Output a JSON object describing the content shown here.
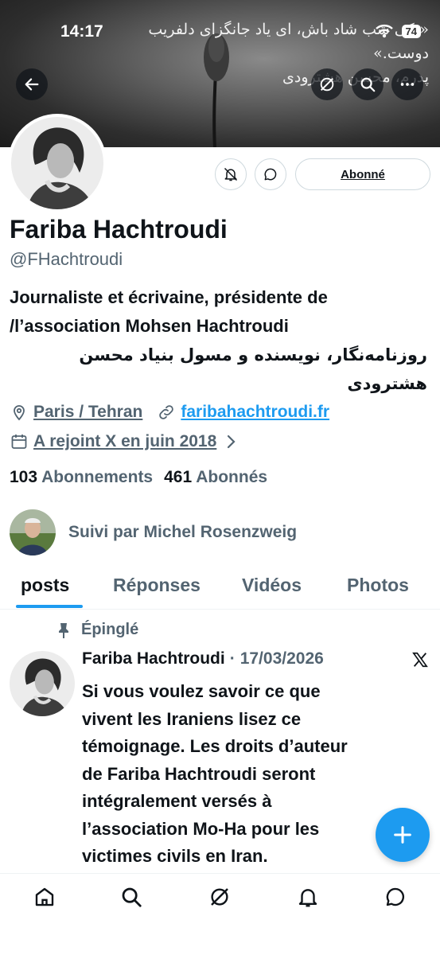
{
  "status_bar": {
    "time": "14:17",
    "battery": "74"
  },
  "header": {
    "banner_quote_lines": [
      "«یکی شب شاد باش، ای یاد جانگزای دلفریب",
      "دوست.»",
      "پدرم، محسن هشترودی"
    ],
    "back_icon": "back-arrow-icon",
    "grok_icon": "grok-icon",
    "search_icon": "search-icon",
    "more_icon": "more-icon"
  },
  "profile": {
    "name": "Fariba Hachtroudi",
    "handle": "@FHachtroudi",
    "follow_button": "Abonné",
    "bio_fr_1": "Journaliste et écrivaine, présidente de",
    "bio_fr_2": "/l’association Mohsen Hachtroudi",
    "bio_fa_1": "روزنامه‌نگار، نویسنده و مسول بنیاد محسن",
    "bio_fa_2": "هشترودی",
    "location": "Paris / Tehran",
    "website": "faribahachtroudi.fr",
    "joined": "A rejoint X en juin 2018",
    "following_count": "103",
    "following_label": "Abonnements",
    "followers_count": "461",
    "followers_label": "Abonnés",
    "followed_by": "Suivi par Michel Rosenzweig"
  },
  "tabs": [
    "posts",
    "Réponses",
    "Vidéos",
    "Photos"
  ],
  "pinned_tweet": {
    "pinned_label": "Épinglé",
    "author": "Fariba Hachtroudi",
    "separator": "·",
    "date": "17/03/2026",
    "text_lines": [
      "Si vous voulez savoir ce que",
      "vivent les Iraniens lisez ce",
      "témoignage. Les droits d’auteur",
      "de Fariba Hachtroudi seront",
      "intégralement versés à",
      "l’association Mo-Ha pour les",
      "victimes civils en Iran."
    ]
  },
  "colors": {
    "accent": "#1d9bf0",
    "text": "#0f1419",
    "muted": "#536471",
    "border": "#cfd9de"
  },
  "bottom_nav": [
    "home-icon",
    "search-icon",
    "grok-icon",
    "notifications-icon",
    "messages-icon"
  ]
}
